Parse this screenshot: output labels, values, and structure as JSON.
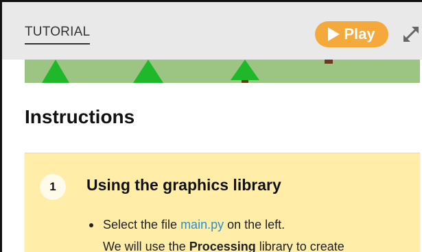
{
  "header": {
    "tab_label": "TUTORIAL",
    "play_label": "Play",
    "play_icon": "play-triangle-icon",
    "expand_icon": "expand-arrows-icon",
    "play_color": "#f5a93a",
    "bar_color": "#e9e9e9"
  },
  "preview": {
    "ground_color": "#9cc483",
    "tree_color": "#1fb82b",
    "trunk_color": "#6b3a1c"
  },
  "main": {
    "title": "Instructions"
  },
  "steps": [
    {
      "number": "1",
      "title": "Using the graphics library",
      "bullet": {
        "line1_prefix": "Select the file ",
        "line1_link": "main.py",
        "line1_suffix": " on the left.",
        "line2_prefix": "We will use the ",
        "line2_bold": "Processing",
        "line2_suffix": " library to create"
      },
      "card_color": "#ffeda8"
    }
  ]
}
